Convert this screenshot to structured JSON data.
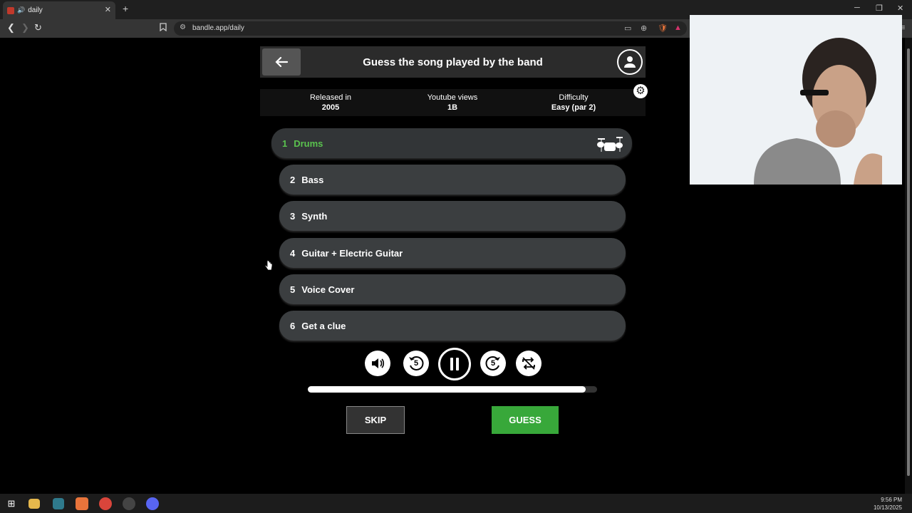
{
  "browser": {
    "tab_title": "daily",
    "tab_close": "✕",
    "new_tab": "+",
    "url": "bandle.app/daily",
    "win_min": "─",
    "win_restore": "❐",
    "win_close": "✕"
  },
  "header": {
    "title": "Guess the song played by the band"
  },
  "info": {
    "released_label": "Released in",
    "released_value": "2005",
    "views_label": "Youtube views",
    "views_value": "1B",
    "difficulty_label": "Difficulty",
    "difficulty_value": "Easy (par 2)"
  },
  "tracks": [
    {
      "num": "1",
      "label": "Drums",
      "state": "active"
    },
    {
      "num": "2",
      "label": "Bass"
    },
    {
      "num": "3",
      "label": "Synth"
    },
    {
      "num": "4",
      "label": "Guitar + Electric Guitar"
    },
    {
      "num": "5",
      "label": "Voice Cover"
    },
    {
      "num": "6",
      "label": "Get a clue"
    }
  ],
  "controls": {
    "volume_icon": "volume-icon",
    "rewind_label": "5",
    "forward_label": "5",
    "play_state": "pause"
  },
  "progress": {
    "fraction": 0.96
  },
  "actions": {
    "skip": "SKIP",
    "guess": "GUESS"
  },
  "taskbar": {
    "time": "9:56 PM",
    "date": "10/13/2025"
  },
  "colors": {
    "accent_green": "#38a83a",
    "active_track_text": "#5ac24e",
    "track_bg": "#3b3e40"
  }
}
